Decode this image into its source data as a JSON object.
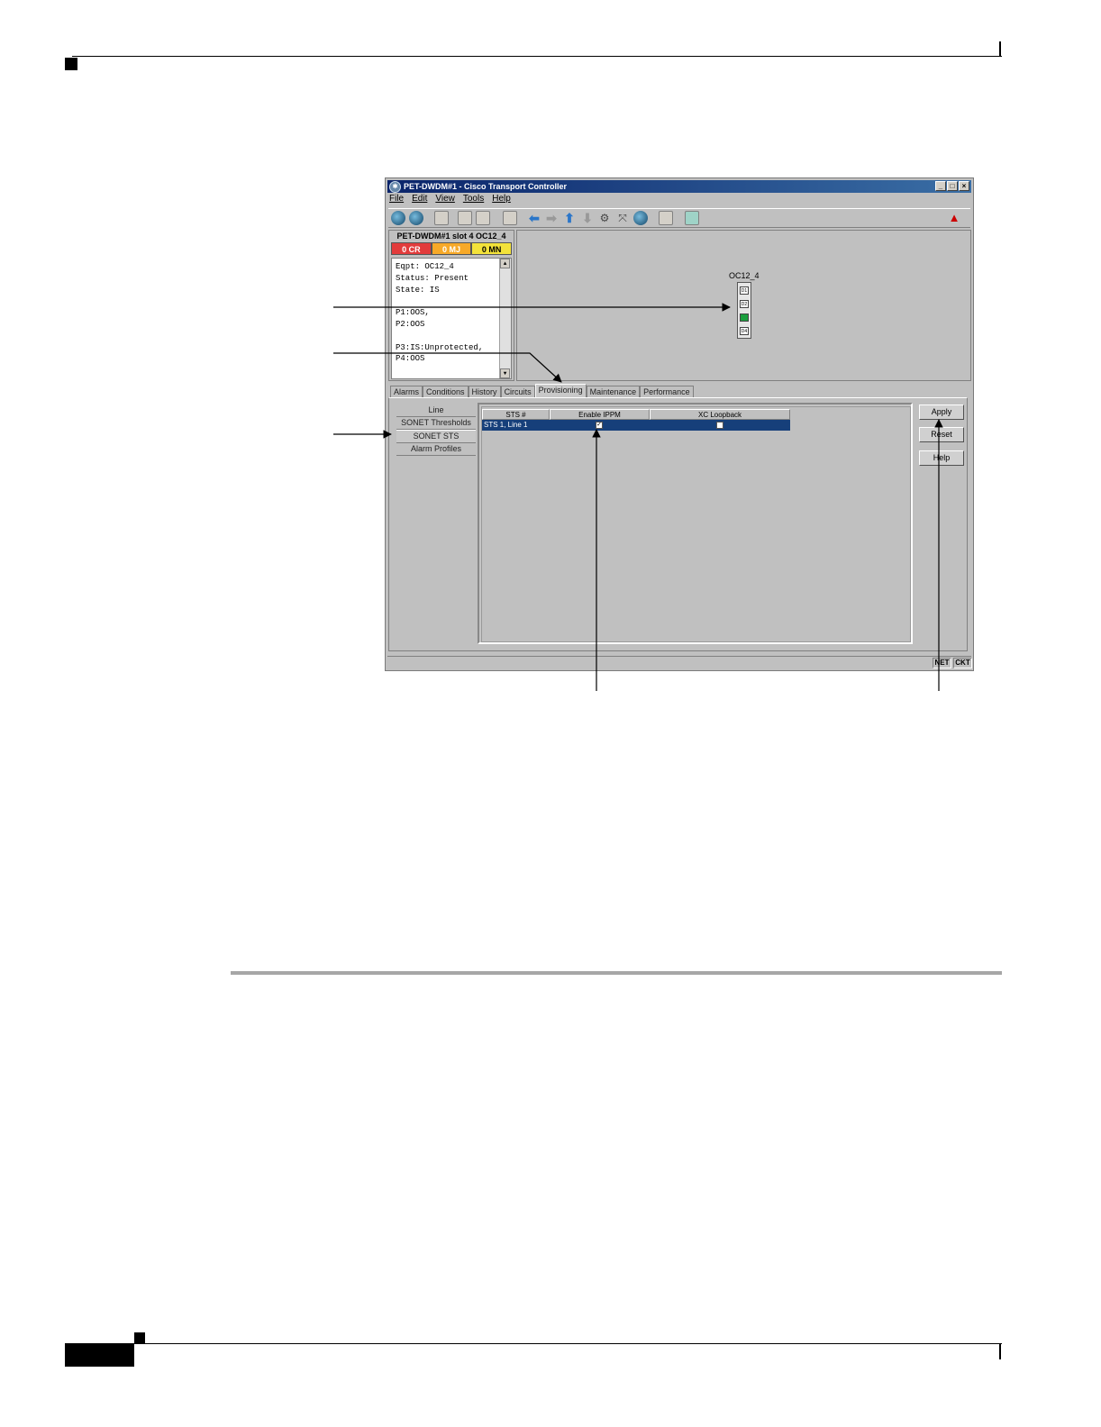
{
  "window": {
    "title": "PET-DWDM#1 - Cisco Transport Controller",
    "controls": [
      "_",
      "□",
      "×"
    ],
    "menu": [
      "File",
      "Edit",
      "View",
      "Tools",
      "Help"
    ]
  },
  "card_view": {
    "title": "PET-DWDM#1 slot 4 OC12_4",
    "alarms": {
      "critical": "0 CR",
      "major": "0 MJ",
      "minor": "0 MN"
    },
    "info_lines": [
      "Eqpt: OC12_4",
      "Status: Present",
      "State: IS",
      "",
      "P1:OOS,",
      "P2:OOS",
      "",
      "P3:IS:Unprotected,",
      "P4:OOS"
    ],
    "card_label": "OC12_4",
    "ports": [
      "D1",
      "D2",
      "",
      "D4"
    ]
  },
  "tabs": [
    "Alarms",
    "Conditions",
    "History",
    "Circuits",
    "Provisioning",
    "Maintenance",
    "Performance"
  ],
  "active_tab": "Provisioning",
  "subtabs": [
    "Line",
    "SONET Thresholds",
    "SONET STS",
    "Alarm Profiles"
  ],
  "active_subtab": "SONET STS",
  "table": {
    "headers": [
      "STS #",
      "Enable IPPM",
      "XC Loopback"
    ],
    "rows": [
      {
        "sts": "STS 1, Line 1",
        "enable_ippm": true,
        "xc_loopback": false
      }
    ]
  },
  "buttons": {
    "apply": "Apply",
    "reset": "Reset",
    "help": "Help"
  },
  "status_bar": {
    "net": "NET",
    "ckt": "CKT"
  },
  "colors": {
    "critical": "#e23b3b",
    "major": "#f7a928",
    "minor": "#f3e23a",
    "selection": "#163f7a",
    "titlebar": "#0a246a"
  }
}
